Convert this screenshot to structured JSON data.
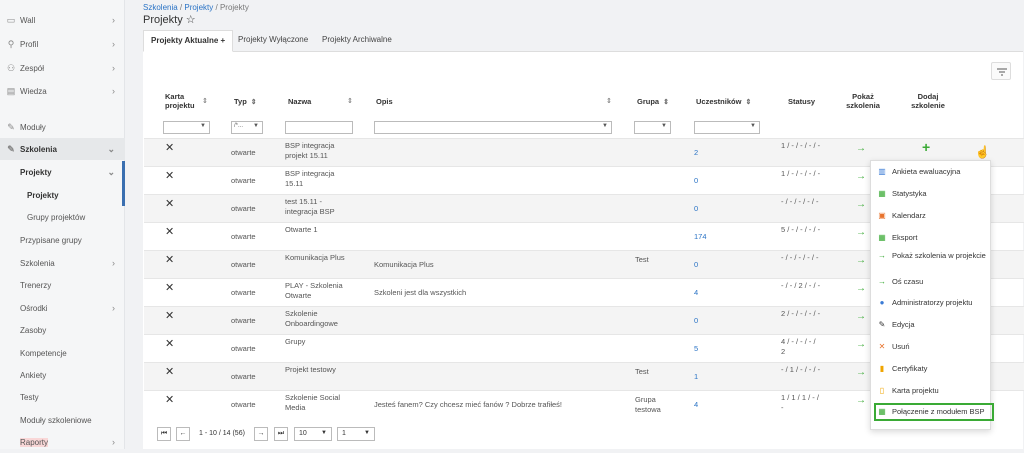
{
  "sidebar": {
    "items": [
      {
        "label": "Wall",
        "icon": "chat-icon"
      },
      {
        "label": "Profil",
        "icon": "user-icon"
      },
      {
        "label": "Zespół",
        "icon": "team-icon"
      },
      {
        "label": "Wiedza",
        "icon": "book-icon"
      },
      {
        "label": "Moduły",
        "icon": "wrench-icon"
      },
      {
        "label": "Szkolenia",
        "icon": "wrench-icon"
      }
    ],
    "sub": [
      {
        "label": "Projekty"
      },
      {
        "label": "Projekty"
      },
      {
        "label": "Grupy projektów"
      },
      {
        "label": "Przypisane grupy"
      },
      {
        "label": "Szkolenia"
      },
      {
        "label": "Trenerzy"
      },
      {
        "label": "Ośrodki"
      },
      {
        "label": "Zasoby"
      },
      {
        "label": "Kompetencje"
      },
      {
        "label": "Ankiety"
      },
      {
        "label": "Testy"
      },
      {
        "label": "Moduły szkoleniowe"
      },
      {
        "label": "Raporty"
      }
    ]
  },
  "breadcrumb": {
    "part1": "Szkolenia",
    "sep1": " / ",
    "part2": "Projekty",
    "sep2": " / ",
    "part3": "Projekty"
  },
  "page_title": "Projekty ☆",
  "tabs": [
    {
      "label": "Projekty Aktualne +"
    },
    {
      "label": "Projekty Wyłączone"
    },
    {
      "label": "Projekty Archiwalne"
    }
  ],
  "table": {
    "headers": {
      "karta": "Karta projektu",
      "typ": "Typ",
      "nazwa": "Nazwa",
      "opis": "Opis",
      "grupa": "Grupa",
      "uczestnikow": "Uczestników",
      "statusy": "Statusy",
      "pokaz": "Pokaż szkolenia",
      "dodaj": "Dodaj szkolenie"
    },
    "filter_typ": "/*...",
    "rows": [
      {
        "typ": "otwarte",
        "nazwa": "BSP integracja projekt 15.11",
        "opis": "",
        "grupa": "",
        "uczestnikow": "2",
        "statusy": "1 / - / - / - / -"
      },
      {
        "typ": "otwarte",
        "nazwa": "BSP integracja 15.11",
        "opis": "",
        "grupa": "",
        "uczestnikow": "0",
        "statusy": "1 / - / - / - / -"
      },
      {
        "typ": "otwarte",
        "nazwa": "test 15.11 - integracja BSP",
        "opis": "",
        "grupa": "",
        "uczestnikow": "0",
        "statusy": "- / - / - / - / -"
      },
      {
        "typ": "otwarte",
        "nazwa": "Otwarte 1",
        "opis": "",
        "grupa": "",
        "uczestnikow": "174",
        "statusy": "5 / - / - / - / -"
      },
      {
        "typ": "otwarte",
        "nazwa": "Komunikacja Plus",
        "opis": "Komunikacja Plus",
        "grupa": "Test",
        "uczestnikow": "0",
        "statusy": "- / - / - / - / -"
      },
      {
        "typ": "otwarte",
        "nazwa": "PLAY - Szkolenia Otwarte",
        "opis": "Szkoleni jest dla wszystkich",
        "grupa": "",
        "uczestnikow": "4",
        "statusy": "- / - / 2 / - / -"
      },
      {
        "typ": "otwarte",
        "nazwa": "Szkolenie Onboardingowe",
        "opis": "",
        "grupa": "",
        "uczestnikow": "0",
        "statusy": "2 / - / - / - / -"
      },
      {
        "typ": "otwarte",
        "nazwa": "Grupy",
        "opis": "",
        "grupa": "",
        "uczestnikow": "5",
        "statusy": "4 / - / - / - / 2"
      },
      {
        "typ": "otwarte",
        "nazwa": "Projekt testowy",
        "opis": "",
        "grupa": "Test",
        "uczestnikow": "1",
        "statusy": "- / 1 / - / - / -"
      },
      {
        "typ": "otwarte",
        "nazwa": "Szkolenie Social Media",
        "opis": "Jesteś fanem? Czy chcesz mieć fanów ? Dobrze trafiłeś!",
        "grupa": "Grupa testowa",
        "uczestnikow": "4",
        "statusy": "1 / 1 / 1 / - / -"
      }
    ]
  },
  "pager": {
    "range": "1 - 10 / 14 (56)",
    "per_page": "10",
    "page": "1"
  },
  "menu": {
    "items": [
      {
        "label": "Ankieta ewaluacyjna",
        "icon": "survey-icon",
        "color": "#3a7bd5"
      },
      {
        "label": "Statystyka",
        "icon": "chart-icon",
        "color": "#3aaa35"
      },
      {
        "label": "Kalendarz",
        "icon": "calendar-icon",
        "color": "#e8732c"
      },
      {
        "label": "Eksport",
        "icon": "export-icon",
        "color": "#3aaa35"
      },
      {
        "label": "Pokaż szkolenia w projekcie",
        "icon": "arrow-right-icon",
        "color": "#3aaa35"
      },
      {
        "label": "Oś czasu",
        "icon": "arrow-right-icon",
        "color": "#3aaa35"
      },
      {
        "label": "Administratorzy projektu",
        "icon": "user-icon",
        "color": "#3a7bd5"
      },
      {
        "label": "Edycja",
        "icon": "pencil-icon",
        "color": "#333333"
      },
      {
        "label": "Usuń",
        "icon": "close-icon",
        "color": "#e8732c"
      },
      {
        "label": "Certyfikaty",
        "icon": "bookmark-icon",
        "color": "#f0a500"
      },
      {
        "label": "Karta projektu",
        "icon": "clipboard-icon",
        "color": "#f0a500"
      },
      {
        "label": "Połączenie z modułem BSP",
        "icon": "link-icon",
        "color": "#3aaa35"
      }
    ]
  }
}
